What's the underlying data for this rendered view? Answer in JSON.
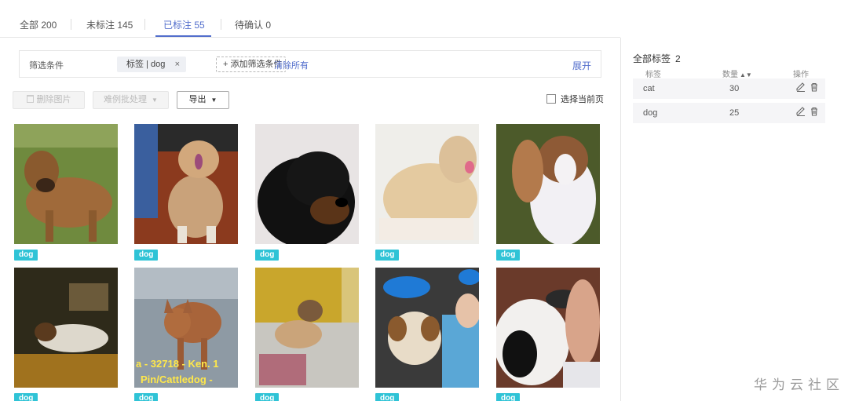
{
  "tabs": [
    {
      "label": "全部 200"
    },
    {
      "label": "未标注 145"
    },
    {
      "label": "已标注 55",
      "active": true
    },
    {
      "label": "待确认 0"
    }
  ],
  "filter": {
    "label": "筛选条件",
    "chip_text": "标签 | dog",
    "chip_close": "×",
    "add_label": "+ 添加筛选条件",
    "clear_label": "清除所有",
    "expand_label": "展开"
  },
  "toolbar": {
    "delete_label": "删除图片",
    "batch_label": "难例批处理",
    "export_label": "导出",
    "select_current_label": "选择当前页"
  },
  "images": [
    {
      "tag": "dog",
      "icon": "dog-photo"
    },
    {
      "tag": "dog",
      "icon": "dog-photo"
    },
    {
      "tag": "dog",
      "icon": "dog-photo"
    },
    {
      "tag": "dog",
      "icon": "dog-photo"
    },
    {
      "tag": "dog",
      "icon": "dog-photo"
    },
    {
      "tag": "dog",
      "icon": "dog-photo"
    },
    {
      "tag": "dog",
      "icon": "dog-photo",
      "overlay_lines": [
        "a - 32718 - Ken. 1",
        "Pin/Cattledog -"
      ]
    },
    {
      "tag": "dog",
      "icon": "dog-photo"
    },
    {
      "tag": "dog",
      "icon": "dog-photo"
    },
    {
      "tag": "dog",
      "icon": "dog-photo"
    }
  ],
  "label_panel": {
    "title": "全部标签",
    "count": "2",
    "headers": {
      "label": "标签",
      "count": "数量",
      "actions": "操作"
    },
    "rows": [
      {
        "name": "cat",
        "count": "30"
      },
      {
        "name": "dog",
        "count": "25"
      }
    ]
  },
  "watermark": "华为云社区",
  "colors": {
    "accent": "#526ecc",
    "tag": "#2fc3d6"
  }
}
